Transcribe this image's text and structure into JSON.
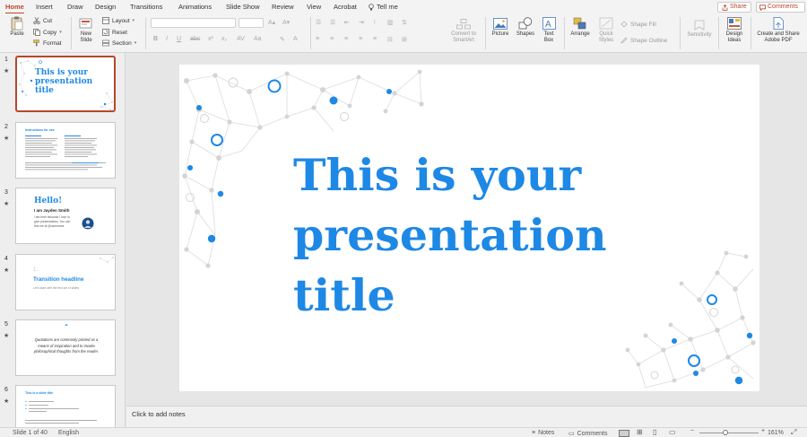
{
  "tabs": [
    "Home",
    "Insert",
    "Draw",
    "Design",
    "Transitions",
    "Animations",
    "Slide Show",
    "Review",
    "View",
    "Acrobat"
  ],
  "tell_me": "Tell me",
  "share_label": "Share",
  "comments_label": "Comments",
  "ribbon": {
    "paste": "Paste",
    "cut": "Cut",
    "copy": "Copy",
    "format": "Format",
    "new_slide": "New Slide",
    "layout": "Layout",
    "reset": "Reset",
    "section": "Section",
    "convert_smartart": "Convert to SmartArt",
    "picture": "Picture",
    "shapes": "Shapes",
    "text_box": "Text Box",
    "arrange": "Arrange",
    "quick_styles": "Quick Styles",
    "shape_fill": "Shape Fill",
    "shape_outline": "Shape Outline",
    "sensitivity": "Sensitivity",
    "design_ideas": "Design Ideas",
    "create_share_pdf": "Create and Share Adobe PDF"
  },
  "slides": [
    {
      "num": "1",
      "title": "This is your presentation title"
    },
    {
      "num": "2",
      "heading": "Instructions for use"
    },
    {
      "num": "3",
      "hello": "Hello!",
      "name": "I am Jayden Smith",
      "body": "I am here because I love to give presentations. You can find me at @username"
    },
    {
      "num": "4",
      "number": "1.",
      "heading": "Transition headline",
      "sub": "Let's start with the first set of slides"
    },
    {
      "num": "5",
      "quote_mark": "“",
      "quote": "Quotations are commonly printed as a means of inspiration and to invoke philosophical thoughts from the reader."
    },
    {
      "num": "6",
      "heading": "This is a slide title"
    }
  ],
  "slide": {
    "title_lines": [
      "This is your",
      "presentation",
      "title"
    ]
  },
  "notes_placeholder": "Click to add notes",
  "status": {
    "slide_of": "Slide 1 of 40",
    "language": "English",
    "notes": "Notes",
    "comments": "Comments",
    "zoom": "161%"
  },
  "colors": {
    "accent": "#b7472a",
    "brand_blue": "#1e88e5"
  }
}
